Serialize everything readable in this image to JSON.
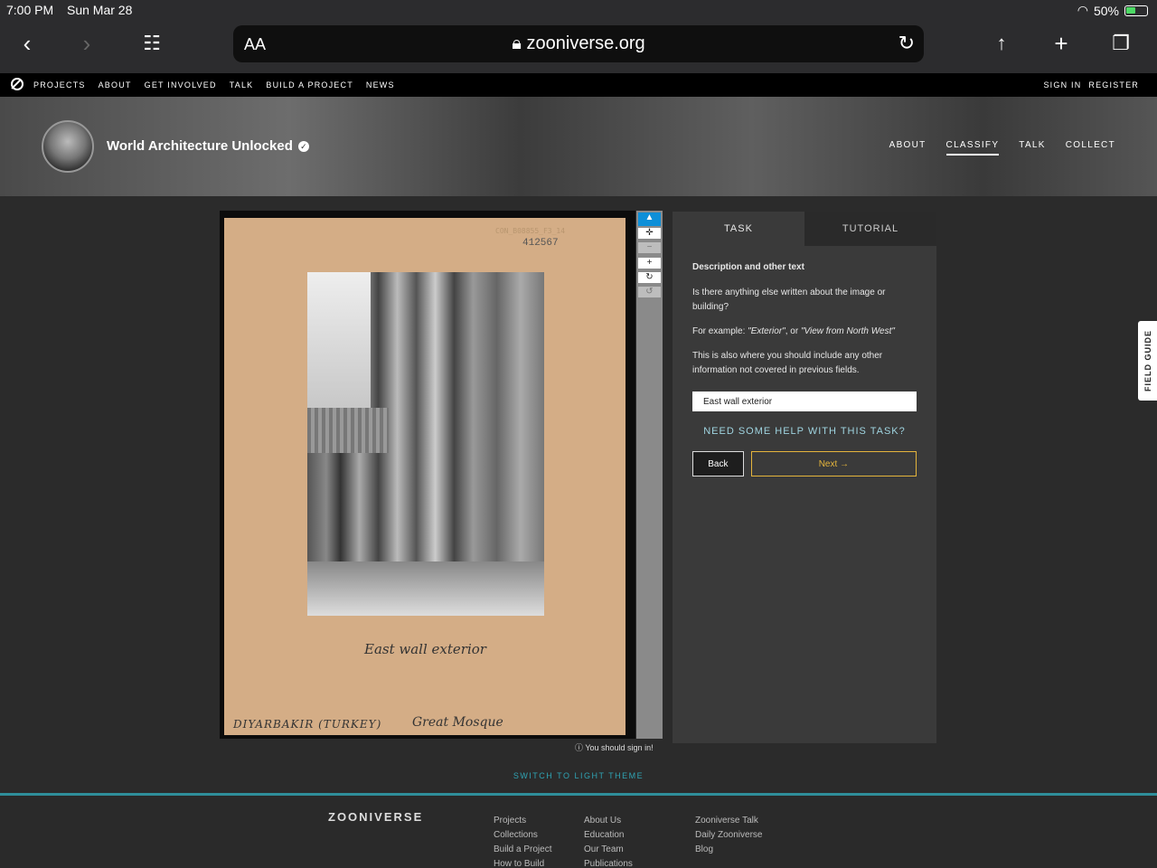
{
  "status": {
    "time": "7:00 PM",
    "date": "Sun Mar 28",
    "battery": "50%"
  },
  "browser": {
    "text_size": "AA",
    "url": "zooniverse.org"
  },
  "zoo_nav": {
    "links": [
      "PROJECTS",
      "ABOUT",
      "GET INVOLVED",
      "TALK",
      "BUILD A PROJECT",
      "NEWS"
    ],
    "sign_in": "SIGN IN",
    "register": "REGISTER"
  },
  "project": {
    "title": "World Architecture Unlocked",
    "nav": [
      "ABOUT",
      "CLASSIFY",
      "TALK",
      "COLLECT"
    ],
    "active_nav": "CLASSIFY"
  },
  "subject": {
    "ref": "CON_B08855_F3_14",
    "number": "412567",
    "caption": "East wall exterior",
    "place": "DIYARBAKIR (TURKEY)",
    "building": "Great Mosque"
  },
  "signin_note": "You should sign in!",
  "task": {
    "tabs": [
      "TASK",
      "TUTORIAL"
    ],
    "heading": "Description and other text",
    "question": "Is there anything else written about the image or building?",
    "example_prefix": "For example: ",
    "example_1": "\"Exterior\"",
    "example_sep": ", or ",
    "example_2": "\"View from North West\"",
    "note": "This is also where you should include any other information not covered in previous fields.",
    "answer_value": "East wall exterior",
    "help": "NEED SOME HELP WITH THIS TASK?",
    "back": "Back",
    "next": "Next →"
  },
  "field_guide": "FIELD GUIDE",
  "theme_toggle": "SWITCH TO LIGHT THEME",
  "footer": {
    "brand": "ZOONIVERSE",
    "col1": [
      "Projects",
      "Collections",
      "Build a Project",
      "How to Build"
    ],
    "col2": [
      "About Us",
      "Education",
      "Our Team",
      "Publications"
    ],
    "col3": [
      "Zooniverse Talk",
      "Daily Zooniverse",
      "Blog"
    ]
  }
}
